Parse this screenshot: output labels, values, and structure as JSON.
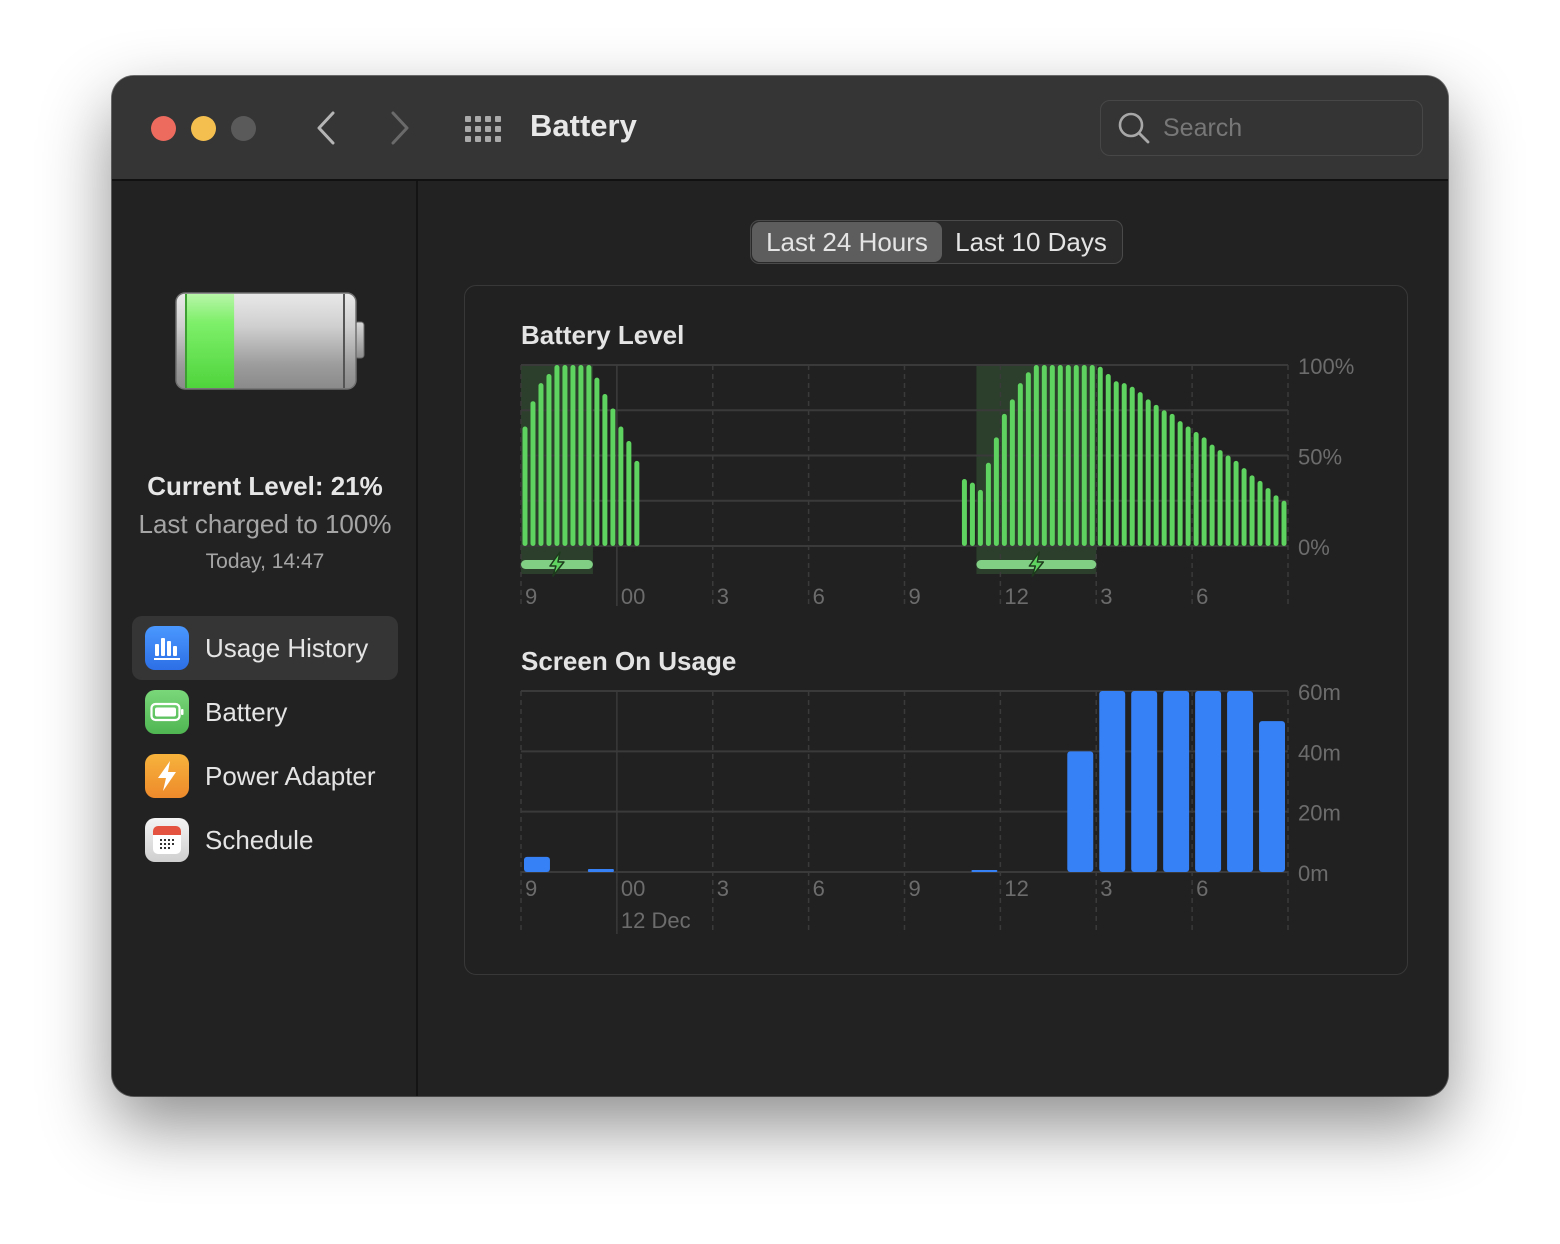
{
  "window": {
    "title": "Battery",
    "search_placeholder": "Search"
  },
  "sidebar": {
    "current_level": "Current Level: 21%",
    "last_charged": "Last charged to 100%",
    "charged_time": "Today, 14:47",
    "battery_fill_percent": 21,
    "items": [
      {
        "label": "Usage History",
        "icon": "bar-chart-icon",
        "active": true
      },
      {
        "label": "Battery",
        "icon": "battery-icon",
        "active": false
      },
      {
        "label": "Power Adapter",
        "icon": "lightning-icon",
        "active": false
      },
      {
        "label": "Schedule",
        "icon": "calendar-icon",
        "active": false
      }
    ]
  },
  "segments": {
    "options": [
      "Last 24 Hours",
      "Last 10 Days"
    ],
    "selected": "Last 24 Hours"
  },
  "help_label": "?",
  "colors": {
    "battery_bar": "#5fd35f",
    "charging_band": "#2c3f2c",
    "charging_indicator": "#80cf85",
    "screen_bar": "#3781f6"
  },
  "chart_data": [
    {
      "type": "bar",
      "title": "Battery Level",
      "xlabel": "",
      "ylabel": "",
      "ylim": [
        0,
        100
      ],
      "yticks": [
        "0%",
        "50%",
        "100%"
      ],
      "ytick_values": [
        0,
        50,
        100
      ],
      "grid": true,
      "x_slots": 96,
      "x_slot_minutes": 15,
      "xtick_labels": [
        "9",
        "00",
        "3",
        "6",
        "9",
        "12",
        "3",
        "6"
      ],
      "xtick_slots": [
        0,
        12,
        24,
        36,
        48,
        60,
        72,
        84
      ],
      "charging_periods": [
        [
          0,
          8
        ],
        [
          57,
          71
        ]
      ],
      "series": [
        {
          "name": "Battery Level",
          "start_slot": 0,
          "values": [
            66,
            80,
            90,
            95,
            100,
            100,
            100,
            100,
            100,
            93,
            84,
            76,
            66,
            58,
            47
          ]
        },
        {
          "name": "Battery Level",
          "start_slot": 55,
          "values": [
            37,
            35,
            31,
            46,
            60,
            73,
            81,
            90,
            96,
            100,
            100,
            100,
            100,
            100,
            100,
            100,
            100,
            99,
            95,
            91,
            90,
            88,
            85,
            81,
            78,
            75,
            73,
            69,
            66,
            63,
            60,
            56,
            53,
            50,
            47,
            43,
            39,
            36,
            32,
            28,
            25
          ]
        }
      ]
    },
    {
      "type": "bar",
      "title": "Screen On Usage",
      "xlabel": "",
      "ylabel": "",
      "ylim": [
        0,
        60
      ],
      "yticks": [
        "0m",
        "20m",
        "40m",
        "60m"
      ],
      "ytick_values": [
        0,
        20,
        40,
        60
      ],
      "grid": true,
      "xtick_labels": [
        "9",
        "00",
        "3",
        "6",
        "9",
        "12",
        "3",
        "6"
      ],
      "xtick_hours": [
        0,
        3,
        6,
        9,
        12,
        15,
        18,
        21
      ],
      "date_label": "12 Dec",
      "categories_hours": 24,
      "values": [
        5,
        0,
        1,
        0,
        0,
        0,
        0,
        0,
        0,
        0,
        0,
        0,
        0,
        0,
        0.5,
        0,
        0,
        40,
        60,
        60,
        60,
        60,
        60,
        50
      ]
    }
  ]
}
